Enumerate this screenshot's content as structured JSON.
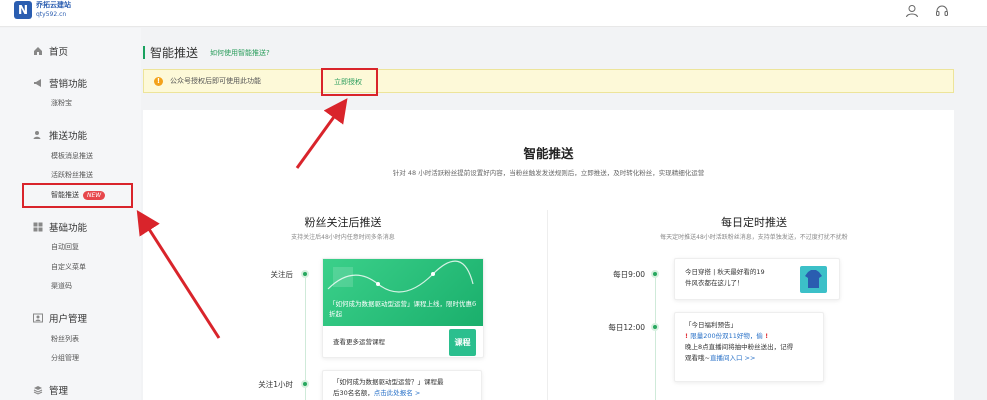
{
  "header": {
    "logo_letter": "N",
    "logo_name": "乔拓云建站",
    "logo_url": "qty592.cn",
    "icons": [
      "user-icon",
      "headset-icon"
    ]
  },
  "sidebar": {
    "home": "首页",
    "marketing": {
      "label": "营销功能",
      "items": [
        "涨粉宝"
      ]
    },
    "push": {
      "label": "推送功能",
      "items": [
        "模板消息推送",
        "活跃粉丝推送",
        "智能推送"
      ],
      "badge": "NEW"
    },
    "basic": {
      "label": "基础功能",
      "items": [
        "自动回复",
        "自定义菜单",
        "渠道码"
      ]
    },
    "users": {
      "label": "用户管理",
      "items": [
        "粉丝列表",
        "分组管理"
      ]
    },
    "manage": {
      "label": "管理"
    }
  },
  "page": {
    "title": "智能推送",
    "help_link": "如何使用智能推送?"
  },
  "notice": {
    "text": "公众号授权后即可使用此功能",
    "link": "立即授权"
  },
  "hero": {
    "title": "智能推送",
    "desc": "针对 48 小时活跃粉丝提前设置好内容，当粉丝触发发送规则后，立即推送，及时转化粉丝，实现精细化运营"
  },
  "left_col": {
    "title": "粉丝关注后推送",
    "subtitle": "支持关注后48小时内任意时间多条消息",
    "timeline": [
      {
        "label": "关注后"
      },
      {
        "label": "关注1小时"
      }
    ],
    "card1": {
      "banner": "「如何成为数据驱动型运营」课程上线，限时优惠6折起",
      "footer": "查看更多运营课程",
      "thumb_label": "课程"
    },
    "card2": {
      "line1": "「如何成为数据驱动型运营？」课程最",
      "line2": "后30名名额，",
      "link": "点击此处报名 >"
    }
  },
  "right_col": {
    "title": "每日定时推送",
    "subtitle": "每天定时推送48小时活跃粉丝消息，支持单独发送，不过度打扰不扰粉",
    "timeline": [
      {
        "label": "每日9:00"
      },
      {
        "label": "每日12:00"
      }
    ],
    "card1": {
      "line1": "今日穿搭 | 秋天最好看的19",
      "line2": "件风衣都在这儿了！"
    },
    "card2": {
      "line1": "「今日福利预告」",
      "line2": "限量200份双11好物，偷",
      "line3": "晚上8点直播间将抽中粉丝送出，记得",
      "line4": "观看哦~",
      "link": "直播间入口 >>"
    }
  },
  "colors": {
    "accent": "#27a85f",
    "annotation": "#d9242b",
    "notice_bg": "#fdf9d8",
    "badge": "#e7474c"
  }
}
